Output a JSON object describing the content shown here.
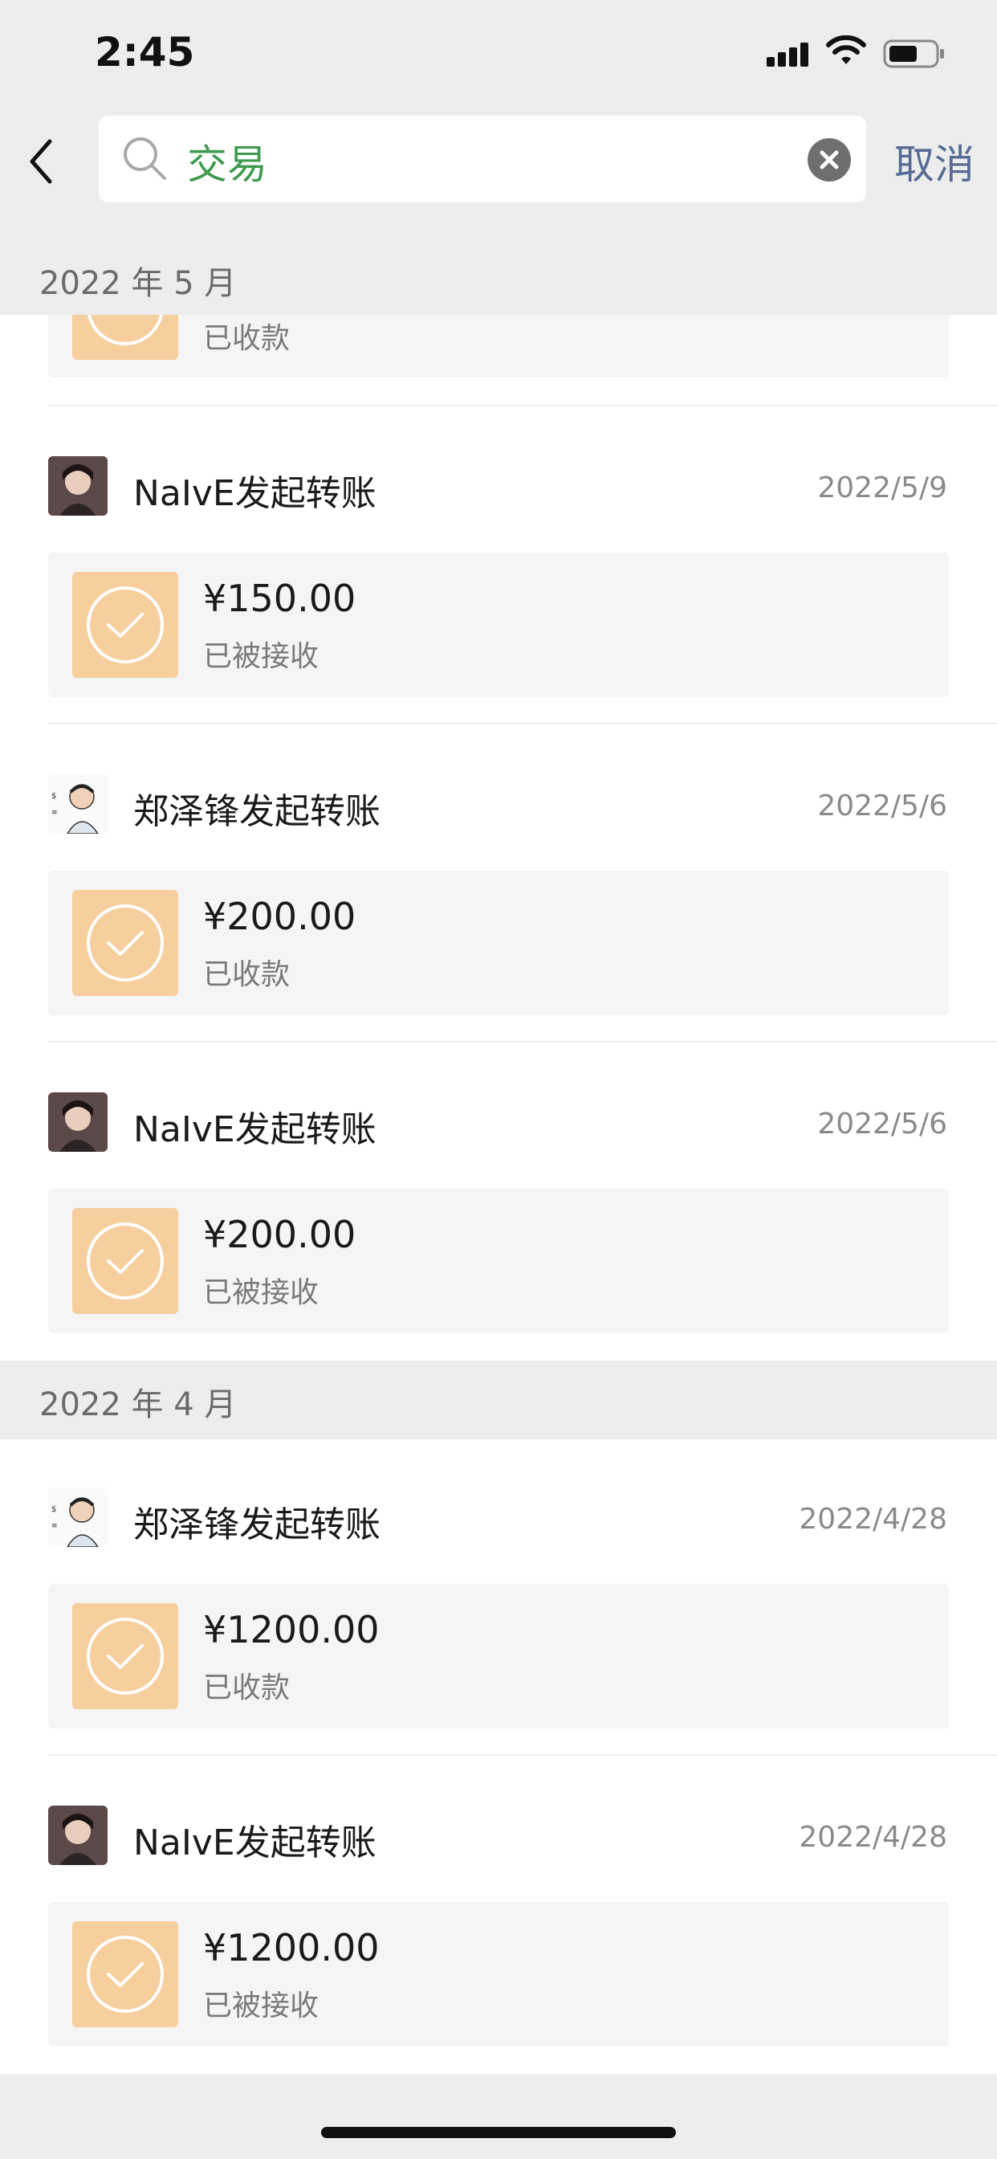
{
  "status_bar": {
    "time": "2:45"
  },
  "search": {
    "query": "交易"
  },
  "nav": {
    "cancel_label": "取消"
  },
  "partial_item": {
    "status": "已收款"
  },
  "sections": [
    {
      "month": "2022 年 5 月"
    },
    {
      "month": "2022 年 4 月"
    }
  ],
  "items": [
    {
      "title": "NaIvE发起转账",
      "date": "2022/5/9",
      "amount": "¥150.00",
      "status": "已被接收",
      "avatar": "girl-photo"
    },
    {
      "title": "郑泽锋发起转账",
      "date": "2022/5/6",
      "amount": "¥200.00",
      "status": "已收款",
      "avatar": "cartoon-man"
    },
    {
      "title": "NaIvE发起转账",
      "date": "2022/5/6",
      "amount": "¥200.00",
      "status": "已被接收",
      "avatar": "girl-photo"
    },
    {
      "title": "郑泽锋发起转账",
      "date": "2022/4/28",
      "amount": "¥1200.00",
      "status": "已收款",
      "avatar": "cartoon-man"
    },
    {
      "title": "NaIvE发起转账",
      "date": "2022/4/28",
      "amount": "¥1200.00",
      "status": "已被接收",
      "avatar": "girl-photo"
    }
  ],
  "colors": {
    "accent_green": "#3f9b50",
    "link_blue": "#576b95",
    "transfer_orange": "#f7cf9f"
  }
}
